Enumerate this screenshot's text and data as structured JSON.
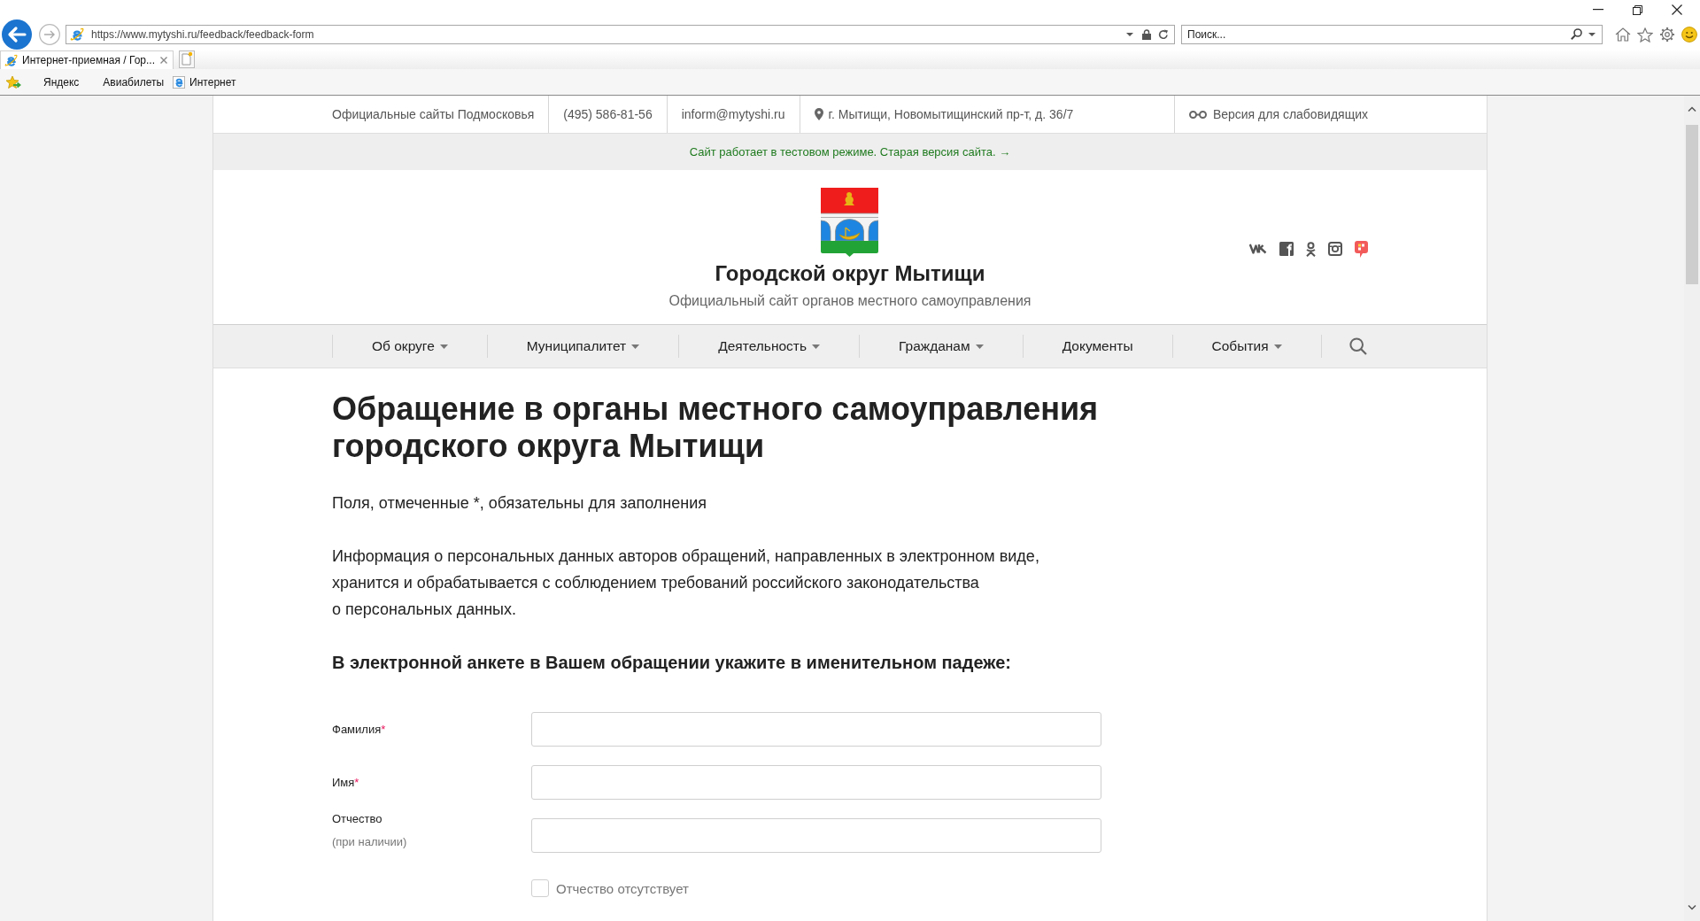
{
  "browser": {
    "address": {
      "url": "https://www.mytyshi.ru/feedback/feedback-form"
    },
    "search": {
      "placeholder": "Поиск..."
    },
    "tabs": [
      {
        "title": "Интернет-приемная / Гор...",
        "selected": true
      }
    ],
    "favorites": [
      {
        "label": "Яндекс",
        "kind": "link"
      },
      {
        "label": "Авиабилеты",
        "kind": "link"
      },
      {
        "label": "Интернет",
        "kind": "page"
      }
    ]
  },
  "site": {
    "top_bar": [
      {
        "kind": "link",
        "label": "Официальные сайты Подмосковья"
      },
      {
        "kind": "link",
        "label": "(495) 586-81-56"
      },
      {
        "kind": "link",
        "label": "inform@mytyshi.ru"
      },
      {
        "kind": "address",
        "label": "г. Мытищи, Новомытищинский пр-т, д. 36/7"
      },
      {
        "kind": "accessibility",
        "label": "Версия для слабовидящих"
      }
    ],
    "notice": "Сайт работает в тестовом режиме. Старая версия сайта. →",
    "header": {
      "title": "Городской округ Мытищи",
      "subtitle": "Официальный сайт органов местного самоуправления"
    },
    "nav": [
      {
        "label": "Об округе",
        "dropdown": true
      },
      {
        "label": "Муниципалитет",
        "dropdown": true
      },
      {
        "label": "Деятельность",
        "dropdown": true
      },
      {
        "label": "Гражданам",
        "dropdown": true
      },
      {
        "label": "Документы",
        "dropdown": false
      },
      {
        "label": "События",
        "dropdown": true
      }
    ]
  },
  "page": {
    "title": "Обращение в органы местного самоуправления городского округа Мытищи",
    "required_note": "Поля, отмеченные *, обязательны для заполнения",
    "privacy_note": "Информация о персональных данных авторов обращений, направленных в электронном виде, хранится и обрабатывается с соблюдением требований российского законодательства о персональных данных.",
    "instruction": "В электронной анкете в Вашем обращении укажите в именительном падеже:"
  },
  "form": {
    "fields": [
      {
        "label": "Фамилия",
        "required_mark": "*"
      },
      {
        "label": "Имя",
        "required_mark": "*"
      },
      {
        "label": "Отчество",
        "note": "(при наличии)"
      }
    ],
    "checkbox": {
      "label": "Отчество отсутствует",
      "checked": false
    }
  }
}
